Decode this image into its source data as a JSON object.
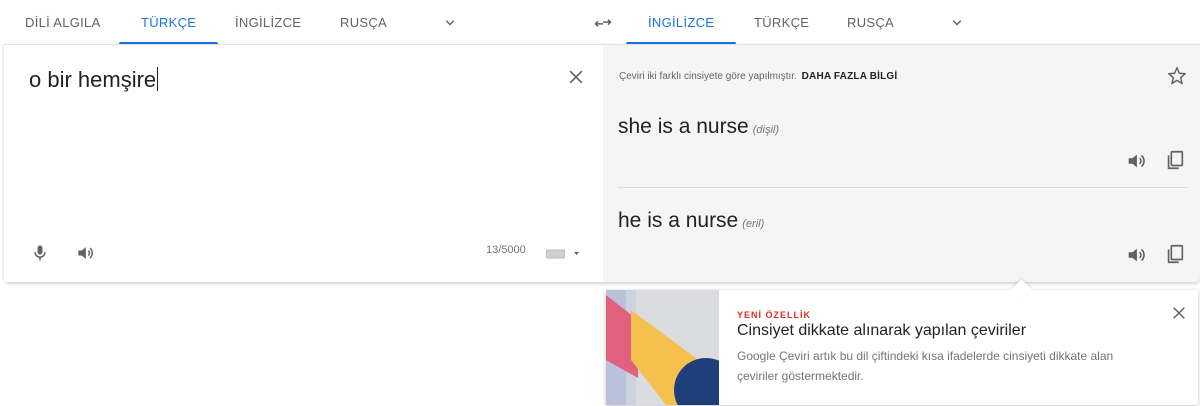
{
  "source_tabs": [
    {
      "label": "DİLİ ALGILA"
    },
    {
      "label": "TÜRKÇE"
    },
    {
      "label": "İNGİLİZCE"
    },
    {
      "label": "RUSÇA"
    }
  ],
  "target_tabs": [
    {
      "label": "İNGİLİZCE"
    },
    {
      "label": "TÜRKÇE"
    },
    {
      "label": "RUSÇA"
    }
  ],
  "active_color": "#1a73e8",
  "source": {
    "text": "o bir hemşire",
    "char_count": "13/5000"
  },
  "target": {
    "notice_text": "Çeviri iki farklı cinsiyete göre yapılmıştır.",
    "notice_link": "DAHA FAZLA BİLGİ",
    "translations": [
      {
        "text": "she is a nurse",
        "gender": "(dişil)"
      },
      {
        "text": "he is a nurse",
        "gender": "(eril)"
      }
    ]
  },
  "popup": {
    "tag": "YENİ ÖZELLİK",
    "title": "Cinsiyet dikkate alınarak yapılan çeviriler",
    "description": "Google Çeviri artık bu dil çiftindeki kısa ifadelerde cinsiyeti dikkate alan çeviriler göstermektedir."
  },
  "icons": [
    "chevron-down-icon",
    "swap-languages-icon",
    "clear-icon",
    "microphone-icon",
    "speaker-icon",
    "keyboard-icon",
    "star-icon",
    "copy-icon",
    "close-icon"
  ]
}
